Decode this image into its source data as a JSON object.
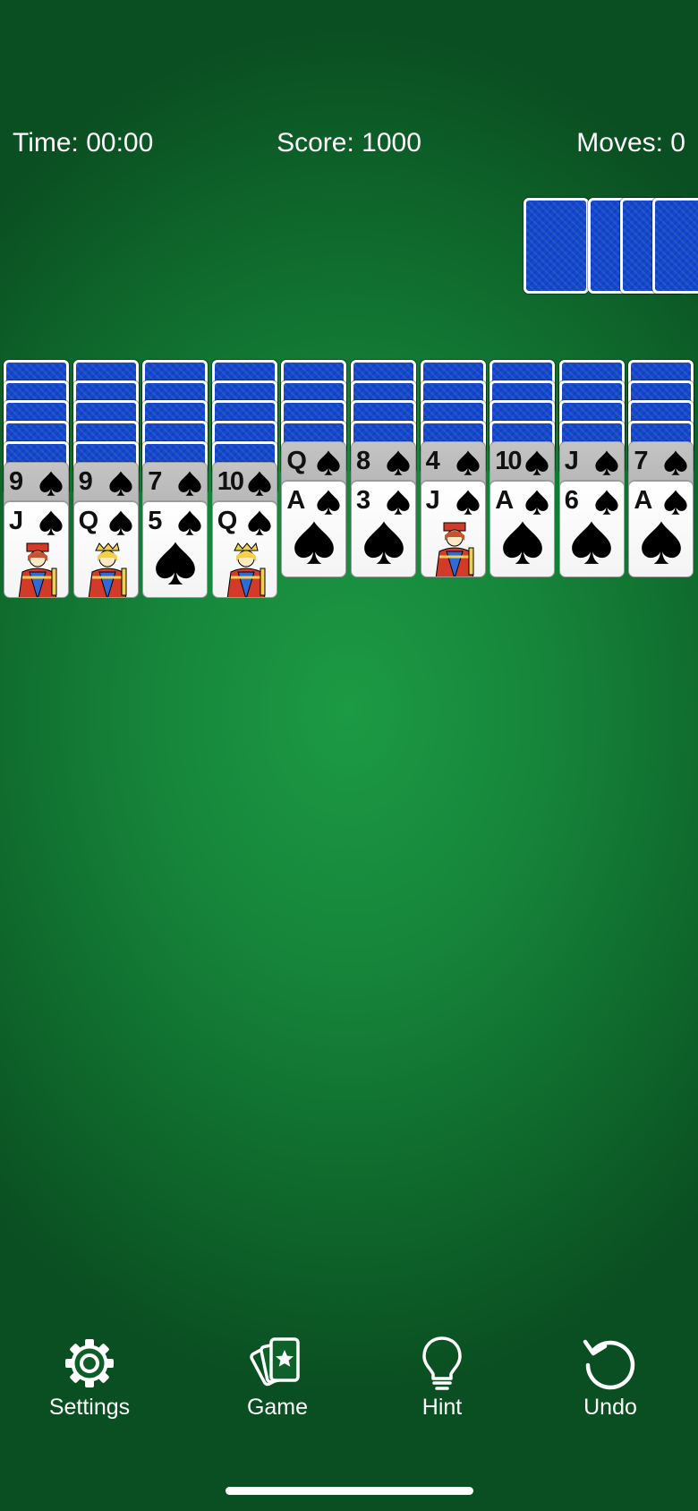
{
  "status_bar": {
    "time": "Time: 00:00",
    "score": "Score: 1000",
    "moves": "Moves: 0"
  },
  "stock": {
    "remaining_deals": 4
  },
  "tableau": [
    {
      "face_down": 5,
      "face_up": [
        {
          "rank": "9",
          "suit": "spade"
        },
        {
          "rank": "J",
          "suit": "spade",
          "court": "jack"
        }
      ]
    },
    {
      "face_down": 5,
      "face_up": [
        {
          "rank": "9",
          "suit": "spade"
        },
        {
          "rank": "Q",
          "suit": "spade",
          "court": "queen"
        }
      ]
    },
    {
      "face_down": 5,
      "face_up": [
        {
          "rank": "7",
          "suit": "spade"
        },
        {
          "rank": "5",
          "suit": "spade"
        }
      ]
    },
    {
      "face_down": 5,
      "face_up": [
        {
          "rank": "10",
          "suit": "spade"
        },
        {
          "rank": "Q",
          "suit": "spade",
          "court": "queen"
        }
      ]
    },
    {
      "face_down": 4,
      "face_up": [
        {
          "rank": "Q",
          "suit": "spade"
        },
        {
          "rank": "A",
          "suit": "spade"
        }
      ]
    },
    {
      "face_down": 4,
      "face_up": [
        {
          "rank": "8",
          "suit": "spade"
        },
        {
          "rank": "3",
          "suit": "spade"
        }
      ]
    },
    {
      "face_down": 4,
      "face_up": [
        {
          "rank": "4",
          "suit": "spade"
        },
        {
          "rank": "J",
          "suit": "spade",
          "court": "jack"
        }
      ]
    },
    {
      "face_down": 4,
      "face_up": [
        {
          "rank": "10",
          "suit": "spade"
        },
        {
          "rank": "A",
          "suit": "spade"
        }
      ]
    },
    {
      "face_down": 4,
      "face_up": [
        {
          "rank": "J",
          "suit": "spade"
        },
        {
          "rank": "6",
          "suit": "spade"
        }
      ]
    },
    {
      "face_down": 4,
      "face_up": [
        {
          "rank": "7",
          "suit": "spade"
        },
        {
          "rank": "A",
          "suit": "spade"
        }
      ]
    }
  ],
  "toolbar": [
    {
      "id": "settings",
      "label": "Settings",
      "icon": "gear-icon"
    },
    {
      "id": "game",
      "label": "Game",
      "icon": "cards-star-icon"
    },
    {
      "id": "hint",
      "label": "Hint",
      "icon": "lightbulb-icon"
    },
    {
      "id": "undo",
      "label": "Undo",
      "icon": "undo-icon"
    }
  ],
  "colors": {
    "felt": "#16853a",
    "card_back": "#1448cf",
    "card_face": "#ffffff",
    "card_face_dim": "#bdbdbd"
  }
}
